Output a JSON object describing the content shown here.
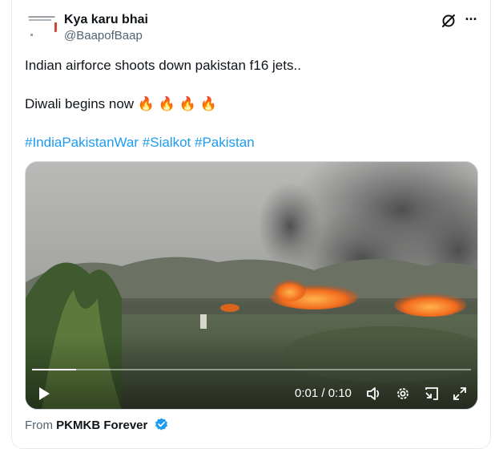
{
  "author": {
    "name": "Kya karu bhai",
    "handle": "@BaapofBaap"
  },
  "post": {
    "line1": "Indian airforce shoots down pakistan f16 jets..",
    "line2": "Diwali begins now 🔥 🔥 🔥 🔥",
    "hashtags": [
      "#IndiaPakistanWar",
      "#Sialkot",
      "#Pakistan"
    ]
  },
  "video": {
    "time_display": "0:01 / 0:10",
    "progress": 0.1,
    "controls": [
      "play-icon",
      "volume-icon",
      "settings-icon",
      "pip-icon",
      "fullscreen-icon"
    ]
  },
  "source": {
    "prefix": "From",
    "name": "PKMKB Forever"
  },
  "colors": {
    "accent": "#1d9bf0",
    "secondary_text": "#536471",
    "flame": "#f26b1d"
  }
}
